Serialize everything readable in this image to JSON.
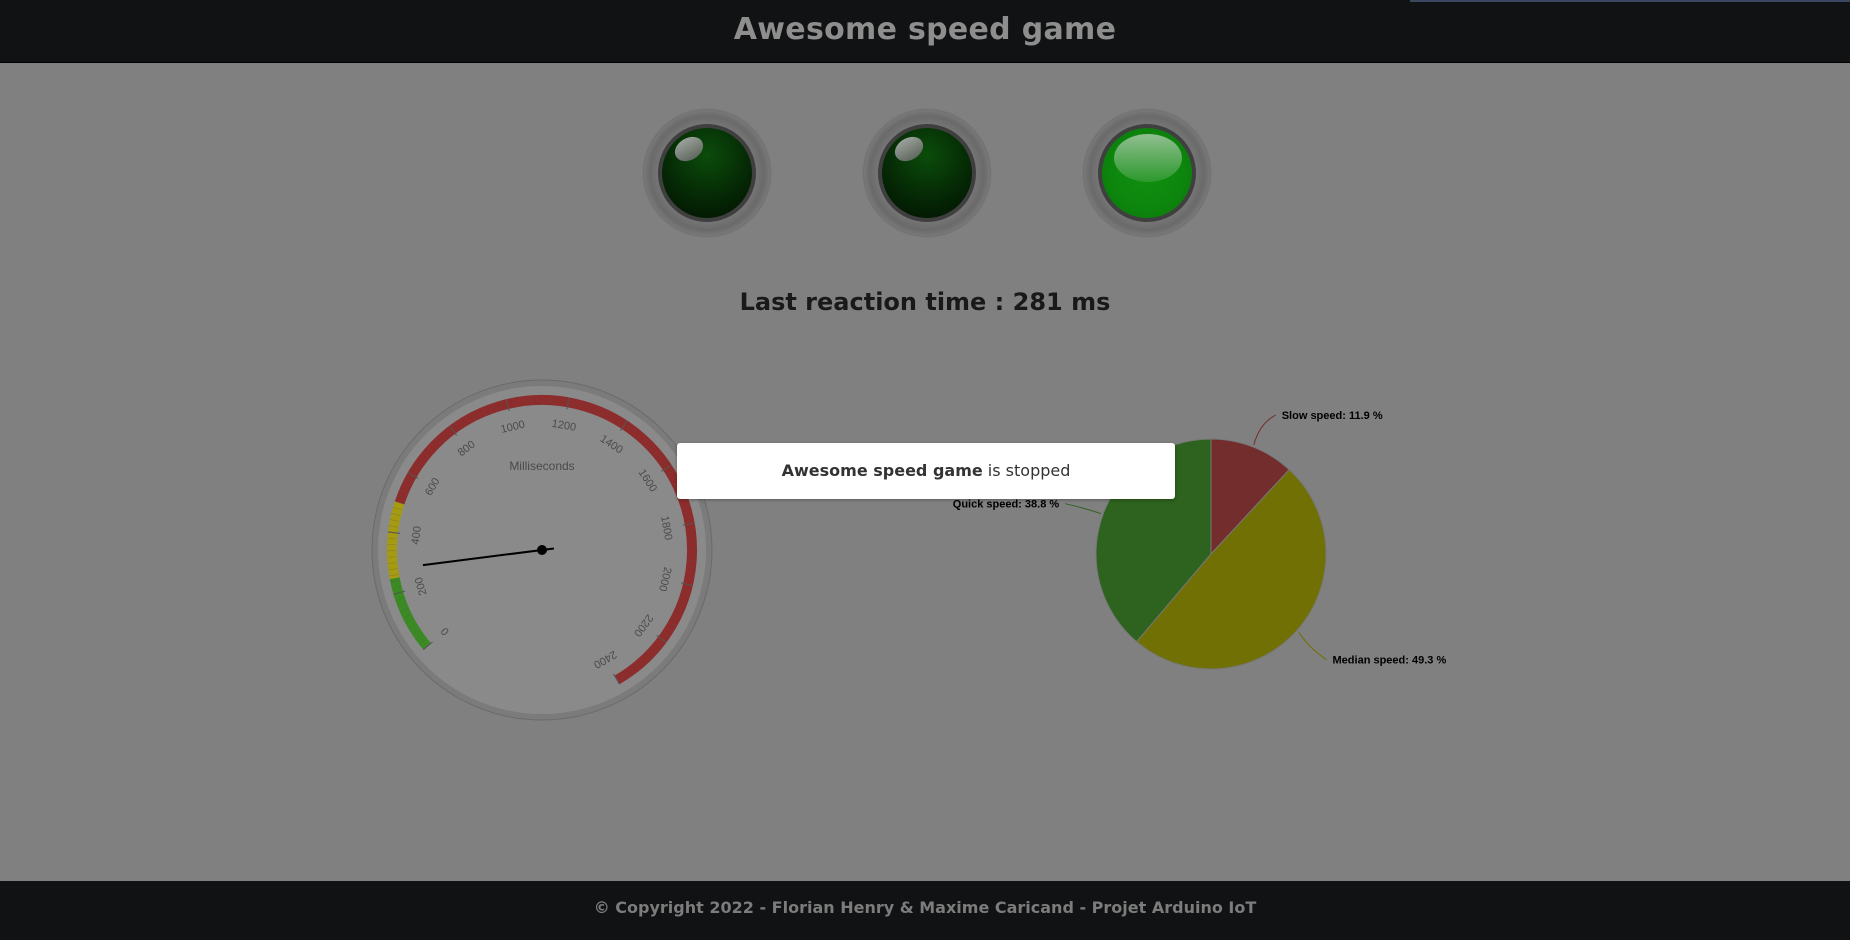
{
  "header": {
    "title": "Awesome speed game"
  },
  "lights": [
    {
      "state": "off",
      "color": "#0a5a0a"
    },
    {
      "state": "off",
      "color": "#0a5a0a"
    },
    {
      "state": "on",
      "color": "#0d8a0d"
    }
  ],
  "reaction": {
    "label": "Last reaction time : ",
    "value": "281",
    "unit": " ms"
  },
  "gauge": {
    "title": "Milliseconds",
    "min": 0,
    "max": 2400,
    "value": 281,
    "ticks": [
      "0",
      "200",
      "400",
      "600",
      "800",
      "1000",
      "1200",
      "1400",
      "1600",
      "1800",
      "2000",
      "2200",
      "2400"
    ],
    "bands": [
      {
        "from": 0,
        "to": 250,
        "color": "#3b8a24"
      },
      {
        "from": 250,
        "to": 500,
        "color": "#a69a13"
      },
      {
        "from": 500,
        "to": 2400,
        "color": "#8e2b2b"
      }
    ]
  },
  "dialog": {
    "name": "Awesome speed game",
    "text": " is stopped"
  },
  "chart_data": {
    "type": "pie",
    "title": "",
    "series": [
      {
        "values": [
          {
            "label": "Slow speed: 11.9 %",
            "value": 11.9,
            "color": "#732d2d"
          },
          {
            "label": "Median speed: 49.3 %",
            "value": 49.3,
            "color": "#707005"
          },
          {
            "label": "Quick speed: 38.8 %",
            "value": 38.8,
            "color": "#2d621f"
          }
        ]
      }
    ]
  },
  "footer": {
    "text": "© Copyright 2022 - Florian Henry & Maxime Caricand - Projet Arduino IoT"
  }
}
